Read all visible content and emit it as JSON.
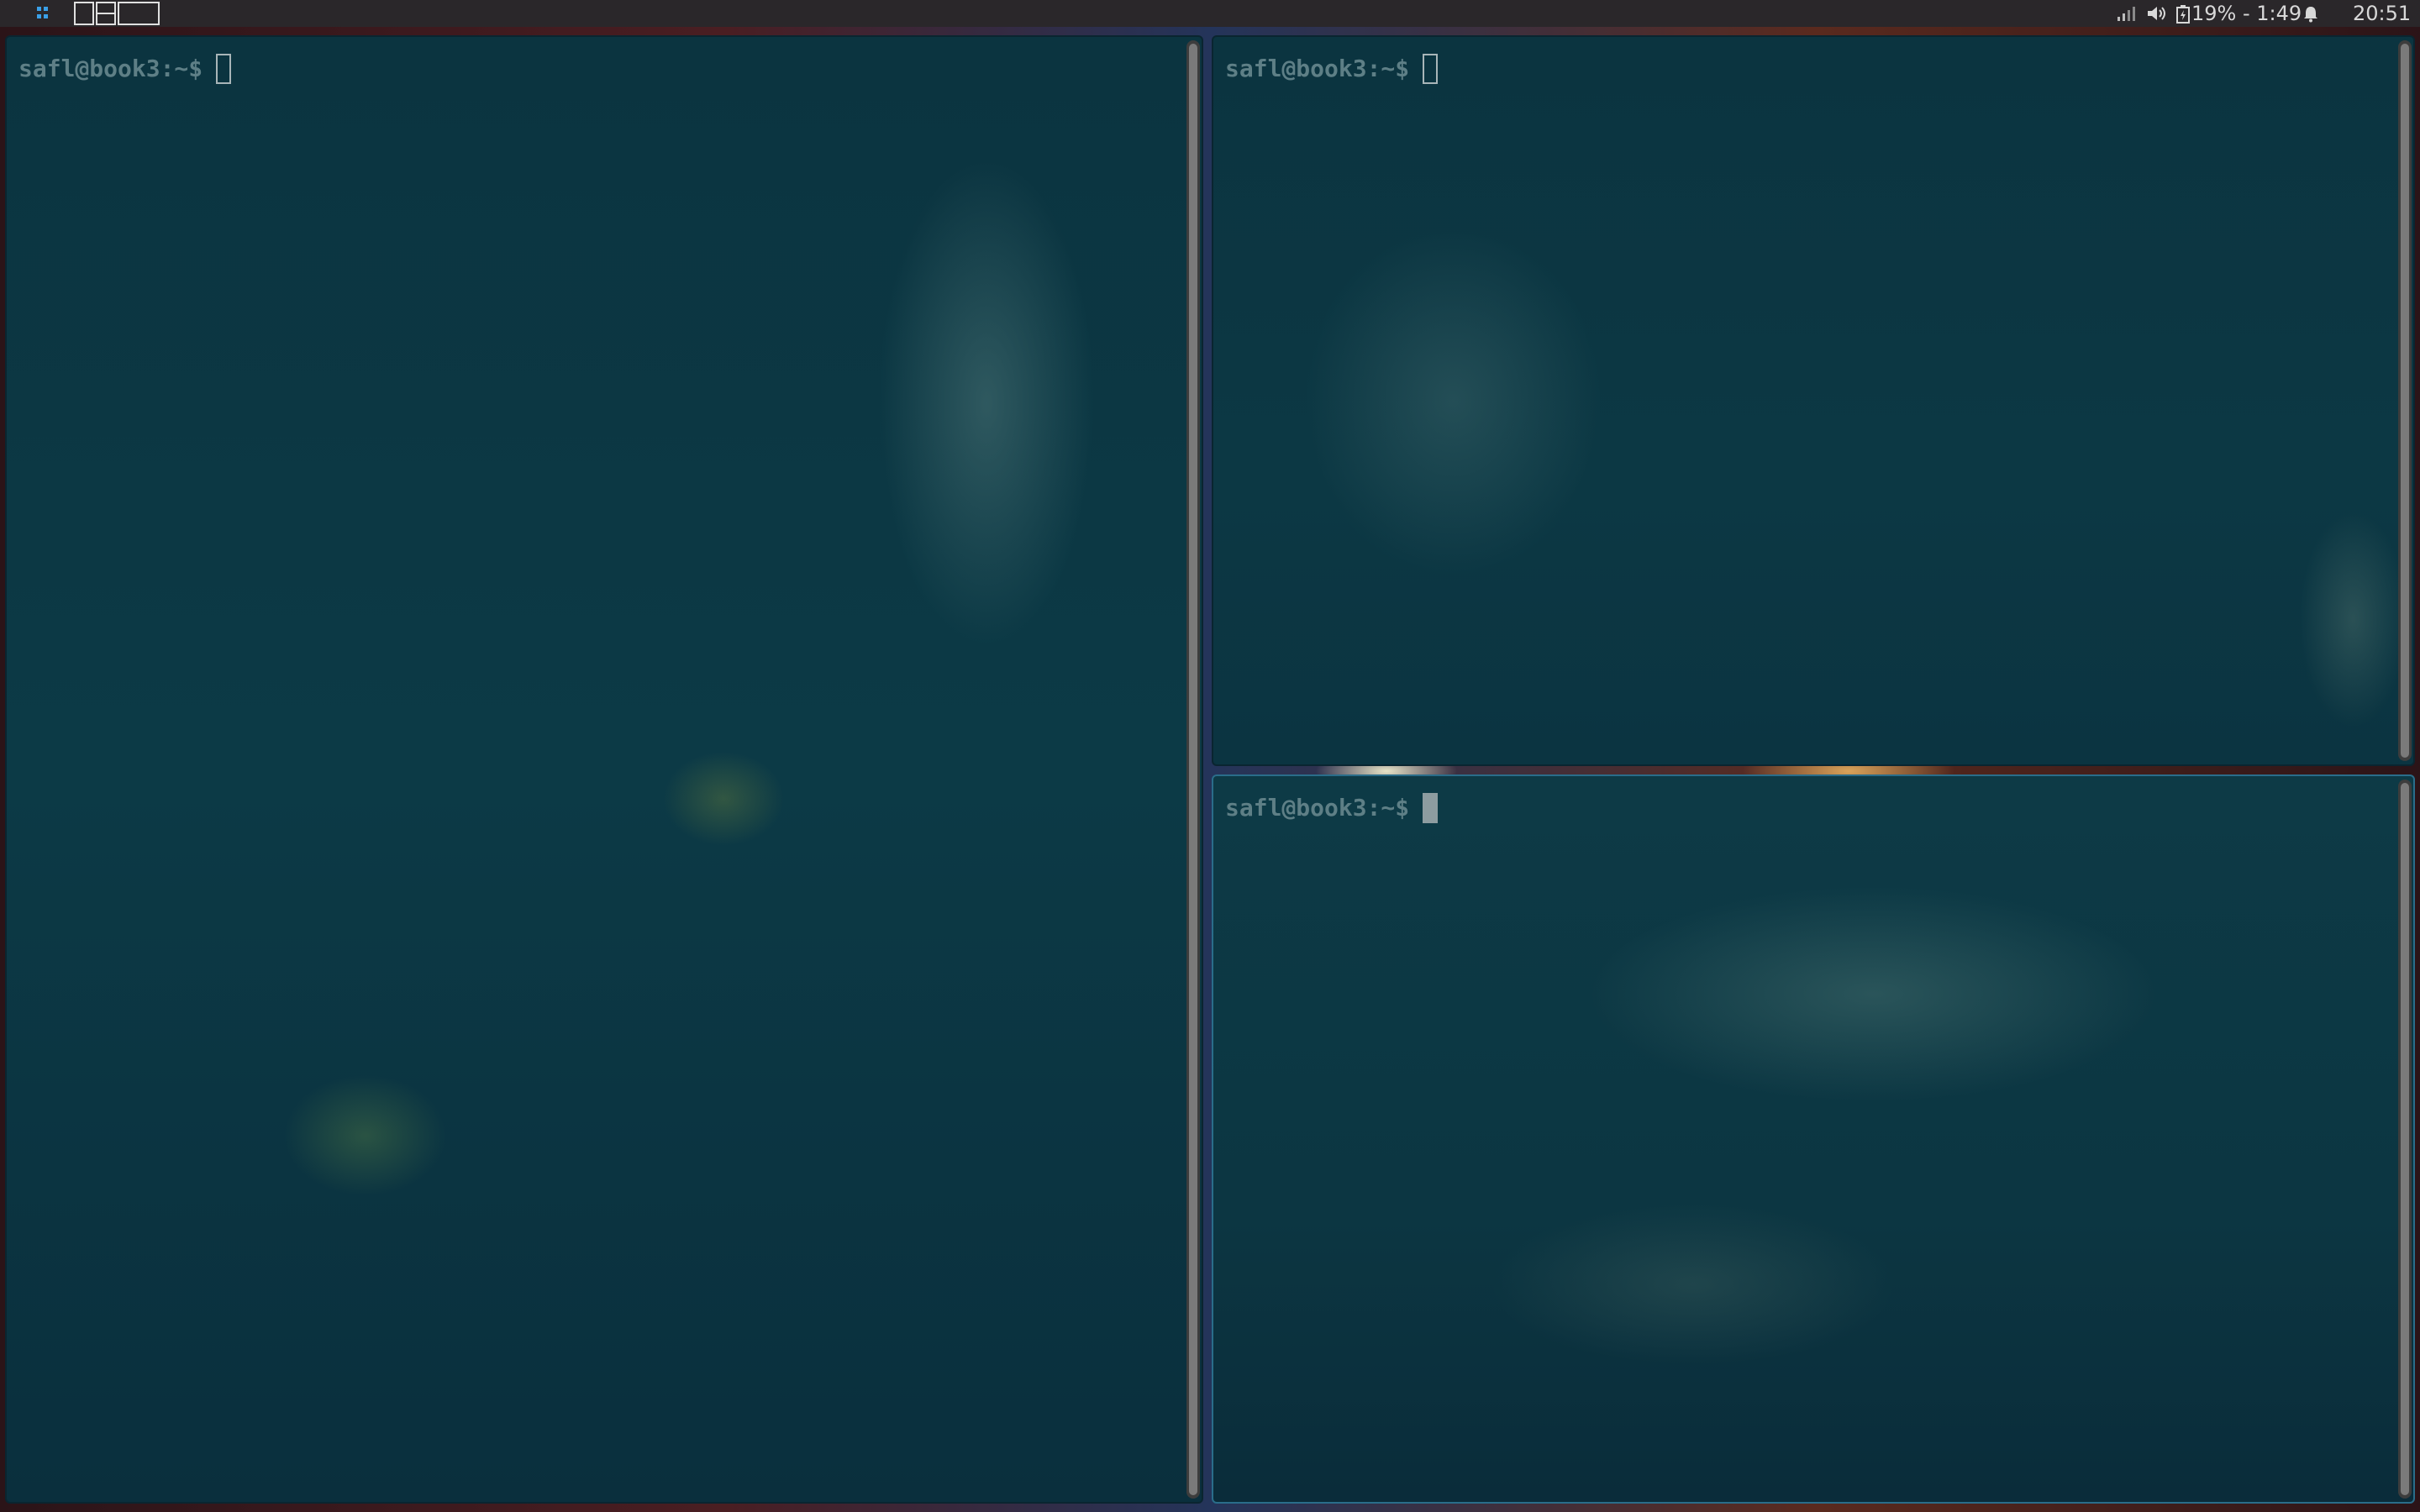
{
  "panel": {
    "menu_icon": "apps-menu-icon",
    "layout_icons": [
      "layout-tiled-icon",
      "layout-stacked-icon",
      "layout-monocle-icon"
    ],
    "signal_icon": "wifi-signal-icon",
    "volume_icon": "volume-icon",
    "battery_icon": "battery-charging-icon",
    "battery_text": "19% - 1:49",
    "notification_icon": "bell-icon",
    "clock": "20:51"
  },
  "terminals": [
    {
      "prompt": "safl@book3:~$",
      "focused": false
    },
    {
      "prompt": "safl@book3:~$",
      "focused": false
    },
    {
      "prompt": "safl@book3:~$",
      "focused": true
    }
  ],
  "colors": {
    "terminal_bg": "#0b3440",
    "prompt_fg": "#5e7f86",
    "panel_bg": "#2a272a",
    "focus_border": "#2a6d8a"
  }
}
